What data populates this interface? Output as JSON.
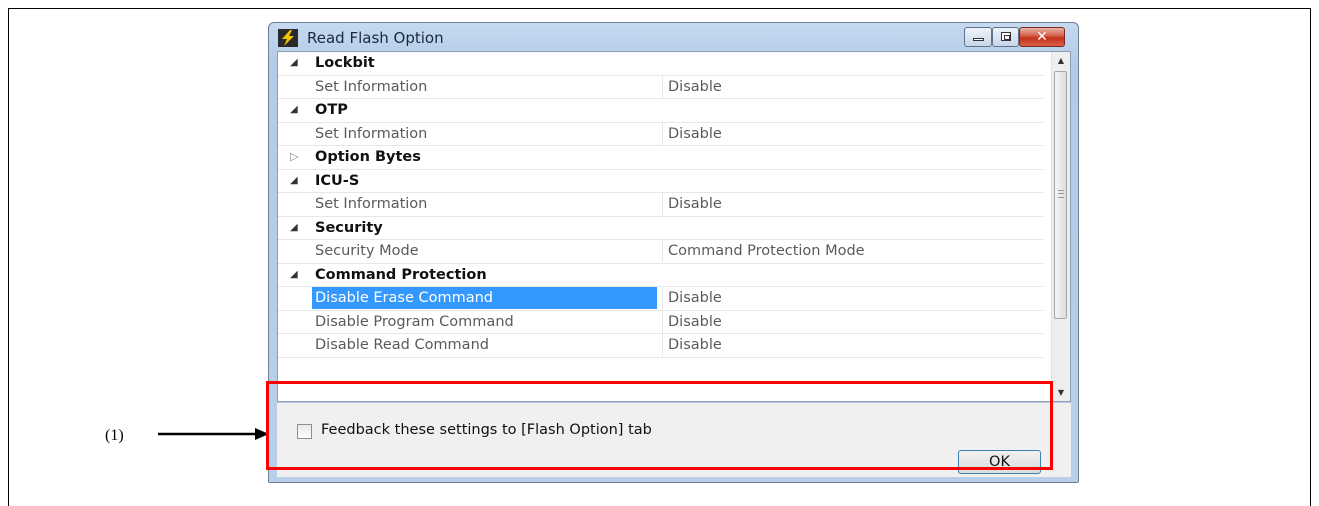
{
  "window": {
    "title": "Read Flash Option"
  },
  "property_grid": {
    "rows": [
      {
        "type": "category",
        "expander": "◢",
        "name": "Lockbit"
      },
      {
        "type": "property",
        "name": "Set Information",
        "value": "Disable"
      },
      {
        "type": "category",
        "expander": "◢",
        "name": "OTP"
      },
      {
        "type": "property",
        "name": "Set Information",
        "value": "Disable"
      },
      {
        "type": "category",
        "expander": "▷",
        "name": "Option Bytes"
      },
      {
        "type": "category",
        "expander": "◢",
        "name": "ICU-S"
      },
      {
        "type": "property",
        "name": "Set Information",
        "value": "Disable"
      },
      {
        "type": "category",
        "expander": "◢",
        "name": "Security"
      },
      {
        "type": "property",
        "name": "Security Mode",
        "value": "Command Protection Mode"
      },
      {
        "type": "category",
        "expander": "◢",
        "name": "Command Protection"
      },
      {
        "type": "property",
        "name": "Disable Erase Command",
        "value": "Disable",
        "selected": true
      },
      {
        "type": "property",
        "name": "Disable Program Command",
        "value": "Disable"
      },
      {
        "type": "property",
        "name": "Disable Read Command",
        "value": "Disable"
      }
    ],
    "selection_color": "#3399ff"
  },
  "footer": {
    "checkbox_label": "Feedback these settings to [Flash Option] tab",
    "checkbox_checked": false,
    "ok_label": "OK"
  },
  "annotation": {
    "label": "(1)",
    "highlight_color": "#ff0000"
  }
}
